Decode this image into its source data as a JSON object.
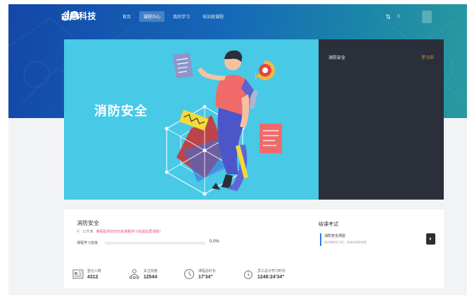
{
  "brand": {
    "name": "金慧科技"
  },
  "nav": {
    "items": [
      {
        "label": "首页",
        "active": false
      },
      {
        "label": "课程中心",
        "active": true
      },
      {
        "label": "我的学习",
        "active": false
      },
      {
        "label": "培训班课程",
        "active": false
      }
    ],
    "user_icon": "switch-arrows-icon",
    "user_name": "3"
  },
  "banner": {
    "title": "消防安全"
  },
  "side_panel": {
    "course_title": "消防安全",
    "status": "学习中"
  },
  "course": {
    "name": "消防安全",
    "visibility": "公开课",
    "notice": "课程提供的时长就课程学习完成后再领取！",
    "progress_label": "课程学习进度",
    "progress_value": "0.0%",
    "progress_fraction": 0.0
  },
  "stats": [
    {
      "icon": "id-card-icon",
      "label": "登记人数",
      "value": "4312"
    },
    {
      "icon": "people-icon",
      "label": "关注热度",
      "value": "12544"
    },
    {
      "icon": "clock-icon",
      "label": "课程总时长",
      "value": "17'34\""
    },
    {
      "icon": "timer-icon",
      "label": "员工总计学习时长",
      "value": "1248:24'34\""
    }
  ],
  "exam": {
    "section_title": "结课考试",
    "item_name": "消防安全测验",
    "item_desc": "测试课程学习后，完成本测验合格"
  },
  "colors": {
    "nav_gradient_start": "#1447a8",
    "nav_gradient_end": "#2a9aa0",
    "banner_bg": "#48c9e6",
    "side_panel_bg": "#2b2f3a",
    "status_orange": "#f1a33b",
    "accent_blue": "#2f7bea"
  }
}
